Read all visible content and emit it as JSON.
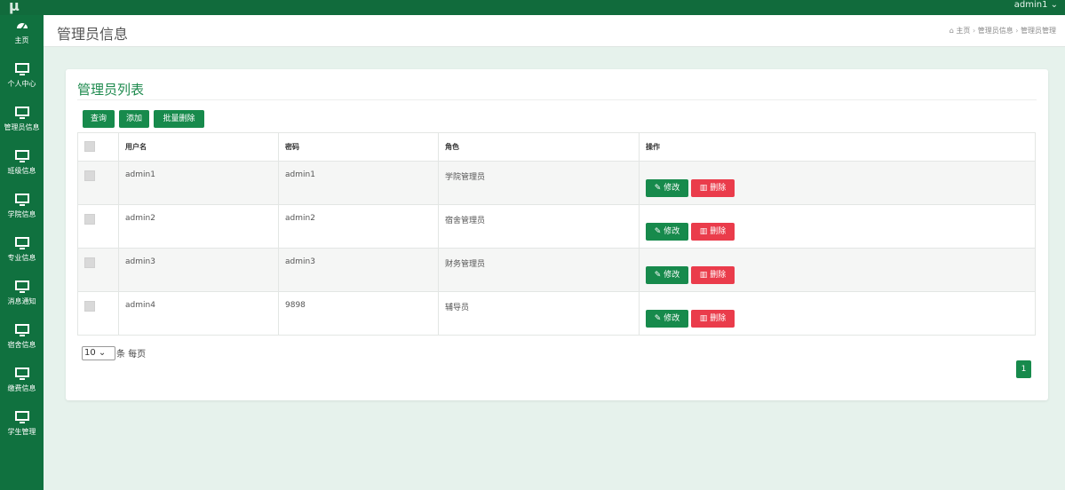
{
  "topbar": {
    "logo": "µ",
    "user": "admin1 ⌄"
  },
  "sidebar": {
    "items": [
      {
        "label": "主页",
        "icon": "dashboard-icon"
      },
      {
        "label": "个人中心",
        "icon": "monitor-icon"
      },
      {
        "label": "管理员信息",
        "icon": "monitor-icon"
      },
      {
        "label": "班级信息",
        "icon": "monitor-icon"
      },
      {
        "label": "学院信息",
        "icon": "monitor-icon"
      },
      {
        "label": "专业信息",
        "icon": "monitor-icon"
      },
      {
        "label": "消息通知",
        "icon": "monitor-icon"
      },
      {
        "label": "宿舍信息",
        "icon": "monitor-icon"
      },
      {
        "label": "缴费信息",
        "icon": "monitor-icon"
      },
      {
        "label": "学生管理",
        "icon": "monitor-icon"
      }
    ]
  },
  "header": {
    "title": "管理员信息",
    "breadcrumb": [
      "主页",
      "管理员信息",
      "管理员管理"
    ],
    "breadcrumb_separator": "›"
  },
  "panel": {
    "title": "管理员列表",
    "buttons": {
      "query": "查询",
      "add": "添加",
      "batch_delete": "批量删除"
    },
    "table": {
      "headers": [
        "用户名",
        "密码",
        "角色",
        "操作"
      ],
      "rows": [
        {
          "username": "admin1",
          "password": "admin1",
          "role": "学院管理员"
        },
        {
          "username": "admin2",
          "password": "admin2",
          "role": "宿舍管理员"
        },
        {
          "username": "admin3",
          "password": "admin3",
          "role": "财务管理员"
        },
        {
          "username": "admin4",
          "password": "9898",
          "role": "辅导员"
        }
      ],
      "edit_label": "修改",
      "delete_label": "删除"
    },
    "pager": {
      "page_size": "10",
      "per_page_label": "条 每页",
      "current_page": "1"
    }
  },
  "colors": {
    "primary": "#178a4c",
    "sidebar": "#10713f",
    "danger": "#ea3c4b"
  }
}
